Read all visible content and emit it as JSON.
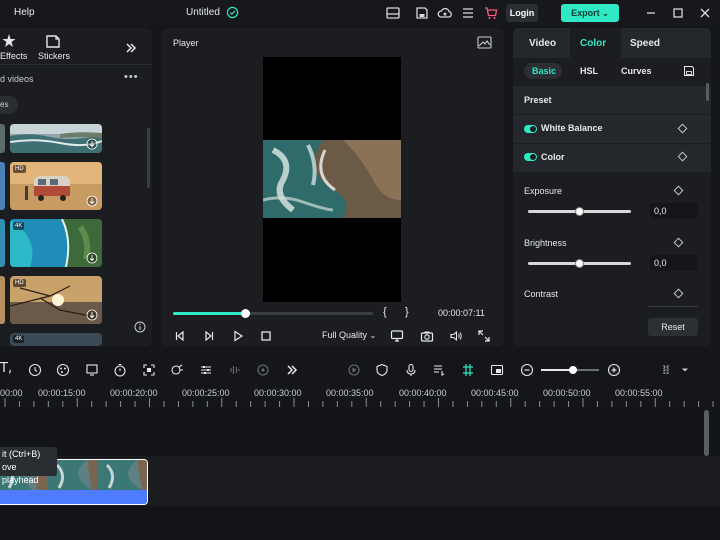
{
  "topbar": {
    "help_label": "Help",
    "project_title": "Untitled",
    "login_label": "Login",
    "export_label": "Export"
  },
  "left_panel": {
    "tabs": [
      {
        "label": "Effects",
        "icon": "effects-icon"
      },
      {
        "label": "Stickers",
        "icon": "stickers-icon"
      }
    ],
    "section_title": "d videos",
    "filter_chip": "es",
    "thumbnails": [
      {
        "badge": "",
        "scene": "ocean waves"
      },
      {
        "badge": "HD",
        "scene": "camper van beach"
      },
      {
        "badge": "4K",
        "scene": "aerial coastline"
      },
      {
        "badge": "HD",
        "scene": "sunset branches"
      }
    ],
    "partial_badge": "4K"
  },
  "player": {
    "title": "Player",
    "timecode": "00:00:07:11",
    "quality_label": "Full Quality",
    "progress": 0.36,
    "brace_open": "{",
    "brace_close": "}"
  },
  "right_panel": {
    "tabs": [
      "Video",
      "Color",
      "Speed"
    ],
    "active_tab": "Color",
    "subtabs": [
      "Basic",
      "HSL",
      "Curves"
    ],
    "active_subtab": "Basic",
    "preset_label": "Preset",
    "white_balance_label": "White Balance",
    "color_label": "Color",
    "exposure": {
      "label": "Exposure",
      "value": "0,0",
      "level": 0.5
    },
    "brightness": {
      "label": "Brightness",
      "value": "0,0",
      "level": 0.5
    },
    "contrast_label": "Contrast",
    "reset_label": "Reset"
  },
  "timeline": {
    "ruler": [
      "00:00",
      "00:00:15:00",
      "00:00:20:00",
      "00:00:25:00",
      "00:00:30:00",
      "00:00:35:00",
      "00:00:40:00",
      "00:00:45:00",
      "00:00:50:00",
      "00:00:55:00"
    ],
    "tooltip_line1": "it (Ctrl+B)",
    "tooltip_line2": "ove playhead",
    "zoom_level": 0.55
  },
  "colors": {
    "accent": "#2fe8c4",
    "clip_blue": "#4f7cff"
  }
}
